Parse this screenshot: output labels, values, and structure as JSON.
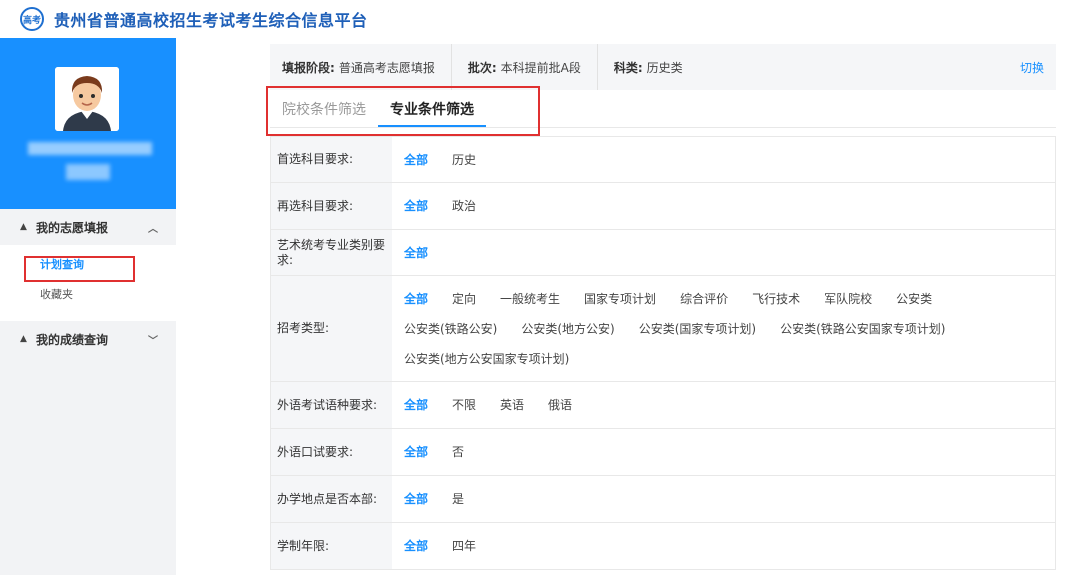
{
  "header": {
    "logo_text": "高考",
    "title": "贵州省普通高校招生考试考生综合信息平台"
  },
  "sidebar": {
    "groups": [
      {
        "label": "我的志愿填报",
        "items": [
          "计划查询",
          "收藏夹"
        ]
      },
      {
        "label": "我的成绩查询"
      }
    ]
  },
  "infobar": {
    "stage_key": "填报阶段:",
    "stage_val": "普通高考志愿填报",
    "batch_key": "批次:",
    "batch_val": "本科提前批A段",
    "subject_key": "科类:",
    "subject_val": "历史类",
    "switch": "切换"
  },
  "tabs": [
    "院校条件筛选",
    "专业条件筛选"
  ],
  "filters": [
    {
      "label": "首选科目要求:",
      "options": [
        "全部",
        "历史"
      ]
    },
    {
      "label": "再选科目要求:",
      "options": [
        "全部",
        "政治"
      ]
    },
    {
      "label": "艺术统考专业类别要求:",
      "options": [
        "全部"
      ]
    },
    {
      "label": "招考类型:",
      "options": [
        "全部",
        "定向",
        "一般统考生",
        "国家专项计划",
        "综合评价",
        "飞行技术",
        "军队院校",
        "公安类",
        "公安类(铁路公安)",
        "公安类(地方公安)",
        "公安类(国家专项计划)",
        "公安类(铁路公安国家专项计划)",
        "公安类(地方公安国家专项计划)"
      ]
    },
    {
      "label": "外语考试语种要求:",
      "options": [
        "全部",
        "不限",
        "英语",
        "俄语"
      ]
    },
    {
      "label": "外语口试要求:",
      "options": [
        "全部",
        "否"
      ]
    },
    {
      "label": "办学地点是否本部:",
      "options": [
        "全部",
        "是"
      ]
    },
    {
      "label": "学制年限:",
      "options": [
        "全部",
        "四年"
      ]
    }
  ]
}
